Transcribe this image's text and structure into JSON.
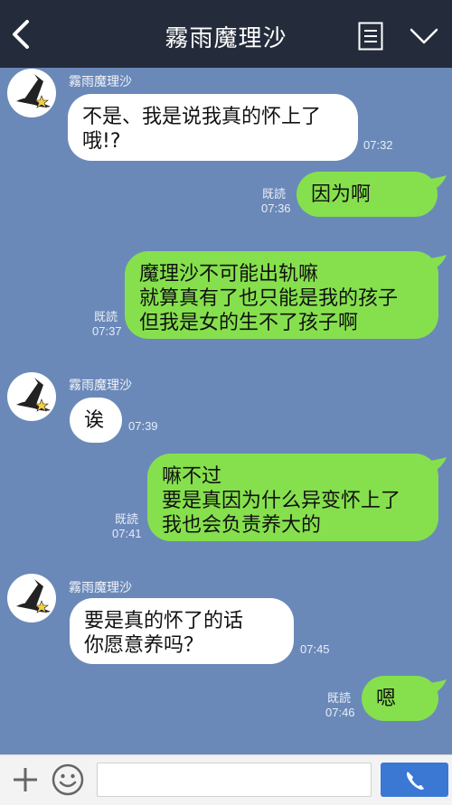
{
  "header": {
    "title": "霧雨魔理沙"
  },
  "messages": [
    {
      "direction": "in",
      "sender": "霧雨魔理沙",
      "lines": [
        "不是、我是说我真的怀上了",
        "哦!?"
      ],
      "time": "07:32"
    },
    {
      "direction": "out",
      "lines": [
        "因为啊"
      ],
      "read": "既読",
      "time": "07:36"
    },
    {
      "direction": "out",
      "lines": [
        "魔理沙不可能出轨嘛",
        "就算真有了也只能是我的孩子",
        "但我是女的生不了孩子啊"
      ],
      "read": "既読",
      "time": "07:37"
    },
    {
      "direction": "in",
      "sender": "霧雨魔理沙",
      "lines": [
        "诶"
      ],
      "time": "07:39"
    },
    {
      "direction": "out",
      "lines": [
        "嘛不过",
        "要是真因为什么异变怀上了",
        "我也会负责养大的"
      ],
      "read": "既読",
      "time": "07:41"
    },
    {
      "direction": "in",
      "sender": "霧雨魔理沙",
      "lines": [
        "要是真的怀了的话",
        "你愿意养吗？"
      ],
      "time": "07:45"
    },
    {
      "direction": "out",
      "lines": [
        "嗯"
      ],
      "read": "既読",
      "time": "07:46"
    }
  ],
  "input": {
    "value": ""
  },
  "icons": {
    "back": "chevron-left-icon",
    "menu": "list-icon",
    "expand": "chevron-down-icon",
    "plus": "plus-icon",
    "emoji": "smiley-icon",
    "call": "phone-icon"
  },
  "colors": {
    "background": "#6a89b9",
    "header": "#242b3a",
    "outgoing_bubble": "#86e04d",
    "incoming_bubble": "#ffffff",
    "call_button": "#3a78d4"
  }
}
